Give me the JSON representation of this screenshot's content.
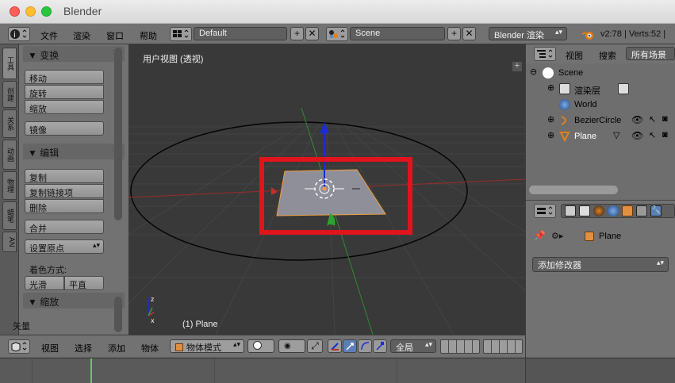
{
  "window": {
    "title": "Blender"
  },
  "info_header": {
    "menus": [
      "文件",
      "渲染",
      "窗口",
      "帮助"
    ],
    "screen_layout": "Default",
    "scene": "Scene",
    "render_engine": "Blender 渲染",
    "stats": "v2:78 | Verts:52 |"
  },
  "tool_tabs": [
    "工具",
    "创建",
    "关系",
    "动画",
    "物理",
    "蜡笔",
    "AN"
  ],
  "tool_shelf": {
    "transform": {
      "title": "▼ 变换",
      "buttons": [
        "移动",
        "旋转",
        "缩放",
        "镜像"
      ]
    },
    "edit": {
      "title": "▼ 编辑",
      "buttons": [
        "复制",
        "复制链接项",
        "删除",
        "合并"
      ],
      "set_origin": "设置原点",
      "shading_label": "着色方式:",
      "smooth": "光滑",
      "flat": "平直"
    },
    "scale_panel": {
      "title": "▼ 缩放",
      "vector_label": "矢量"
    }
  },
  "viewport": {
    "view_name": "用户视图 (透视)",
    "object_label": "(1) Plane"
  },
  "view3d_header": {
    "menus": [
      "视图",
      "选择",
      "添加",
      "物体"
    ],
    "mode": "物体模式",
    "pivot": "全局"
  },
  "outliner": {
    "header": {
      "view": "视图",
      "search": "搜索",
      "filter": "所有场景"
    },
    "items": [
      {
        "label": "Scene"
      },
      {
        "label": "渲染层"
      },
      {
        "label": "World"
      },
      {
        "label": "BezierCircle"
      },
      {
        "label": "Plane"
      }
    ]
  },
  "properties": {
    "context_object": "Plane",
    "add_modifier": "添加修改器"
  },
  "colors": {
    "selection_box": "#e0141c",
    "x_axis": "#c03030",
    "y_axis": "#40a040",
    "z_axis": "#1a2ecc",
    "plane_outline": "#f0a040"
  }
}
